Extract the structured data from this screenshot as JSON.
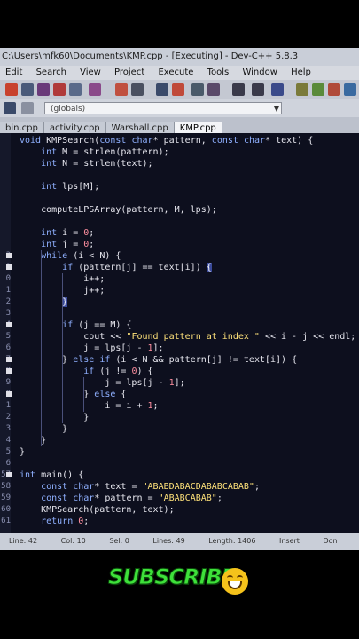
{
  "window": {
    "title": "C:\\Users\\mfk60\\Documents\\KMP.cpp - [Executing] - Dev-C++ 5.8.3"
  },
  "menu": [
    "Edit",
    "Search",
    "View",
    "Project",
    "Execute",
    "Tools",
    "Window",
    "Help"
  ],
  "toolbar": {
    "scope_combo": "(globals)"
  },
  "tabs": [
    "bin.cpp",
    "activity.cpp",
    "Warshall.cpp",
    "KMP.cpp"
  ],
  "active_tab": "KMP.cpp",
  "code": [
    {
      "ln": "",
      "t": "void KMPSearch(const char* pattern, const char* text) {"
    },
    {
      "ln": "",
      "t": "    int M = strlen(pattern);"
    },
    {
      "ln": "",
      "t": "    int N = strlen(text);"
    },
    {
      "ln": "",
      "t": ""
    },
    {
      "ln": "",
      "t": "    int lps[M];"
    },
    {
      "ln": "",
      "t": ""
    },
    {
      "ln": "",
      "t": "    computeLPSArray(pattern, M, lps);"
    },
    {
      "ln": "",
      "t": ""
    },
    {
      "ln": "",
      "t": "    int i = 0;"
    },
    {
      "ln": "",
      "t": "    int j = 0;"
    },
    {
      "ln": "3",
      "t": "    while (i < N) {"
    },
    {
      "ln": "9",
      "t": "        if (pattern[j] == text[i]) {"
    },
    {
      "ln": "0",
      "t": "            i++;"
    },
    {
      "ln": "1",
      "t": "            j++;"
    },
    {
      "ln": "2",
      "t": "        }"
    },
    {
      "ln": "3",
      "t": ""
    },
    {
      "ln": "4",
      "t": "        if (j == M) {"
    },
    {
      "ln": "5",
      "t": "            cout << \"Found pattern at index \" << i - j << endl;"
    },
    {
      "ln": "6",
      "t": "            j = lps[j - 1];"
    },
    {
      "ln": "7",
      "t": "        } else if (i < N && pattern[j] != text[i]) {"
    },
    {
      "ln": "8",
      "t": "            if (j != 0) {"
    },
    {
      "ln": "9",
      "t": "                j = lps[j - 1];"
    },
    {
      "ln": "0",
      "t": "            } else {"
    },
    {
      "ln": "1",
      "t": "                i = i + 1;"
    },
    {
      "ln": "2",
      "t": "            }"
    },
    {
      "ln": "3",
      "t": "        }"
    },
    {
      "ln": "4",
      "t": "    }"
    },
    {
      "ln": "5",
      "t": "}"
    },
    {
      "ln": "6",
      "t": ""
    },
    {
      "ln": "57",
      "t": "int main() {"
    },
    {
      "ln": "58",
      "t": "    const char* text = \"ABABDABACDABABCABAB\";"
    },
    {
      "ln": "59",
      "t": "    const char* pattern = \"ABABCABAB\";"
    },
    {
      "ln": "60",
      "t": "    KMPSearch(pattern, text);"
    },
    {
      "ln": "61",
      "t": "    return 0;"
    }
  ],
  "status": [
    "Line: 42",
    "Col: 10",
    "Sel: 0",
    "Lines: 49",
    "Length: 1406",
    "Insert",
    "Don"
  ],
  "overlay": {
    "subscribe": "SUBSCRIBE",
    "emoji": "smiling-face-icon"
  },
  "colors": {
    "editor_bg": "#0d0f1e",
    "keyword": "#8fb0ff",
    "string": "#ffe27a",
    "subscribe": "#3ee03a"
  }
}
